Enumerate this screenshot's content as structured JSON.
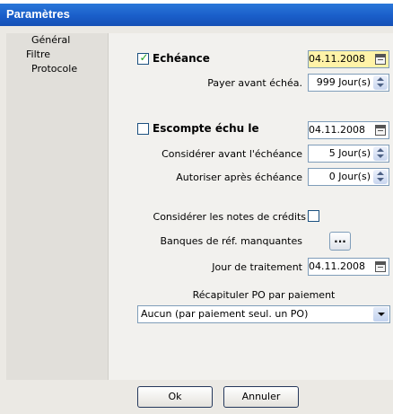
{
  "window": {
    "title": "Paramètres"
  },
  "sidebar": {
    "items": [
      {
        "label": "Général"
      },
      {
        "label": "Filtre"
      },
      {
        "label": "Protocole"
      }
    ]
  },
  "echeance": {
    "label": "Echéance",
    "checked": true,
    "date": "04.11.2008",
    "pay_before_label": "Payer avant échéa.",
    "pay_before_value": "999 Jour(s)"
  },
  "escompte": {
    "label": "Escompte échu le",
    "checked": false,
    "date": "04.11.2008",
    "before_label": "Considérer avant l'échéance",
    "before_value": "5 Jour(s)",
    "after_label": "Autoriser après échéance",
    "after_value": "0 Jour(s)"
  },
  "credit_notes": {
    "label": "Considérer les notes de crédits",
    "checked": false
  },
  "missing_banks": {
    "label": "Banques de réf. manquantes",
    "button": "..."
  },
  "processing_day": {
    "label": "Jour de traitement",
    "date": "04.11.2008"
  },
  "po_summary": {
    "label": "Récapituler PO par paiement",
    "selected": "Aucun (par paiement seul. un PO)"
  },
  "buttons": {
    "ok": "Ok",
    "cancel": "Annuler"
  },
  "colors": {
    "title_bar": "#1a5ec9",
    "highlight_field": "#fff3a8",
    "check_mark": "#21a121"
  }
}
